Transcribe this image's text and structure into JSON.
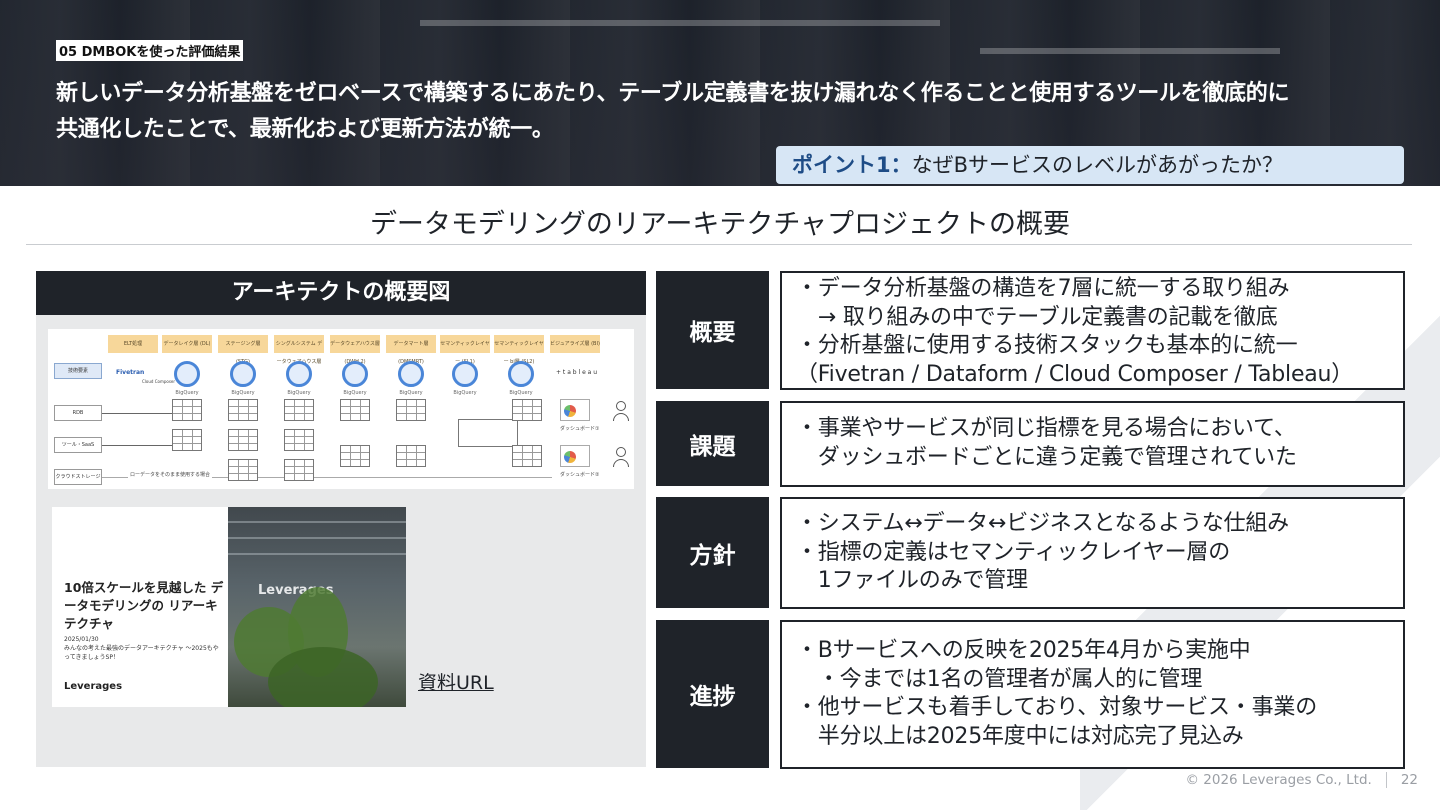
{
  "header": {
    "section_tag": "05 DMBOKを使った評価結果",
    "headline_line1": "新しいデータ分析基盤をゼロベースで構築するにあたり、テーブル定義書を抜け漏れなく作ることと使用するツールを徹底的に",
    "headline_line2": "共通化したことで、最新化および更新方法が統一。",
    "point_label": "ポイント1：",
    "point_text": "なぜBサービスのレベルがあがったか？"
  },
  "subtitle": "データモデリングのリアーキテクチャプロジェクトの概要",
  "left_panel": {
    "title": "アーキテクトの概要図",
    "diagram": {
      "layers": [
        "ELT処理",
        "データレイク層 (DL)",
        "ステージング層 (STG)",
        "シングルシステム データウェアハウス層 (DWH 1)",
        "データウェアハウス層 (DWH 2)",
        "データマート層 (DMSMRT)",
        "セマンティックレイヤー (SL1)",
        "セマンティックレイヤー bi層 (SL2)",
        "ビジュアライズ層 (BI)"
      ],
      "tool_label": "BigQuery",
      "fivetran": "Fivetran",
      "cloud_composer": "Cloud Composer",
      "tableau": "+ t a b l e a u",
      "sources": [
        "RDB",
        "ツール・SaaS",
        "クラウドストレージ"
      ],
      "system_label": "技術要素",
      "raw_note": "ローデータをそのまま使用する場合",
      "dashboards": [
        "ダッシュボード①",
        "ダッシュボード②"
      ]
    },
    "cover": {
      "title": "10倍スケールを見越した データモデリングの リアーキテクチャ",
      "date": "2025/01/30",
      "event": "みんなの考えた最強のデータアーキテクチャ ～2025もやってきましょうSP！",
      "brand": "Leverages",
      "photo_logo": "Leverages"
    },
    "link_label": "資料URL"
  },
  "rows": [
    {
      "label": "概要",
      "text": "・データ分析基盤の構造を7層に統一する取り組み\n　→ 取り組みの中でテーブル定義書の記載を徹底\n・分析基盤に使用する技術スタックも基本的に統一\n（Fivetran / Dataform / Cloud Composer / Tableau）"
    },
    {
      "label": "課題",
      "text": "・事業やサービスが同じ指標を見る場合において、\n　ダッシュボードごとに違う定義で管理されていた"
    },
    {
      "label": "方針",
      "text": "・システム↔データ↔ビジネスとなるような仕組み\n・指標の定義はセマンティックレイヤー層の\n　1ファイルのみで管理"
    },
    {
      "label": "進捗",
      "text": "・Bサービスへの反映を2025年4月から実施中\n　・今までは1名の管理者が属人的に管理\n・他サービスも着手しており、対象サービス・事業の\n　半分以上は2025年度中には対応完了見込み"
    }
  ],
  "footer": {
    "copyright": "© 2026 Leverages Co., Ltd.",
    "page": "22"
  }
}
